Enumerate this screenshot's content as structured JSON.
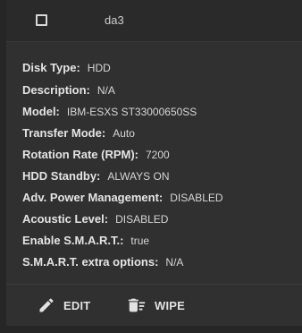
{
  "header": {
    "disk_name": "da3"
  },
  "details": [
    {
      "label": "Disk Type:",
      "value": "HDD"
    },
    {
      "label": "Description:",
      "value": "N/A"
    },
    {
      "label": "Model:",
      "value": "IBM-ESXS ST33000650SS"
    },
    {
      "label": "Transfer Mode:",
      "value": "Auto"
    },
    {
      "label": "Rotation Rate (RPM):",
      "value": "7200"
    },
    {
      "label": "HDD Standby:",
      "value": "ALWAYS ON"
    },
    {
      "label": "Adv. Power Management:",
      "value": "DISABLED"
    },
    {
      "label": "Acoustic Level:",
      "value": "DISABLED"
    },
    {
      "label": "Enable S.M.A.R.T.:",
      "value": "true"
    },
    {
      "label": "S.M.A.R.T. extra options:",
      "value": "N/A"
    }
  ],
  "actions": {
    "edit": {
      "label": "EDIT",
      "icon": "pencil-icon"
    },
    "wipe": {
      "label": "WIPE",
      "icon": "wipe-icon"
    }
  }
}
